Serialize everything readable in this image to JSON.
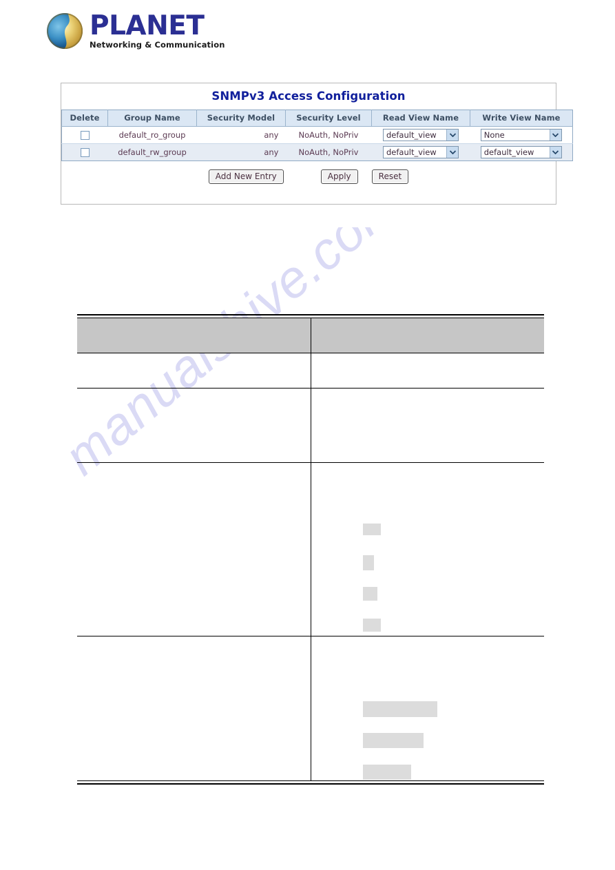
{
  "brand": {
    "name": "PLANET",
    "tagline": "Networking & Communication",
    "logo_icon": "globe-icon",
    "text_color": "#2b2f93"
  },
  "watermark": {
    "text": "manualshive.com",
    "color": "#ccccf2"
  },
  "panel": {
    "title": "SNMPv3 Access Configuration",
    "title_color": "#11209c",
    "table": {
      "columns": [
        "Delete",
        "Group Name",
        "Security Model",
        "Security Level",
        "Read View Name",
        "Write View Name"
      ],
      "rows": [
        {
          "delete_checked": false,
          "group_name": "default_ro_group",
          "security_model": "any",
          "security_level": "NoAuth, NoPriv",
          "read_view_name": "default_view",
          "write_view_name": "None"
        },
        {
          "delete_checked": false,
          "group_name": "default_rw_group",
          "security_model": "any",
          "security_level": "NoAuth, NoPriv",
          "read_view_name": "default_view",
          "write_view_name": "default_view"
        }
      ],
      "header_bg": "#dbe7f4",
      "alt_row_bg": "#e6ecf4"
    },
    "buttons": {
      "add_new_entry": "Add New Entry",
      "apply": "Apply",
      "reset": "Reset"
    }
  },
  "description_table": {
    "header_bg": "#c6c6c6",
    "header_cells": [
      "",
      ""
    ],
    "rows": [
      {
        "left": "",
        "right": "",
        "blocks": []
      },
      {
        "left": "",
        "right": "",
        "blocks": []
      },
      {
        "left": "",
        "right": "",
        "blocks": [
          "sm",
          "xs",
          "sm",
          "sm"
        ]
      },
      {
        "left": "",
        "right": "",
        "blocks": [
          "lg",
          "md",
          "sm"
        ]
      }
    ]
  }
}
